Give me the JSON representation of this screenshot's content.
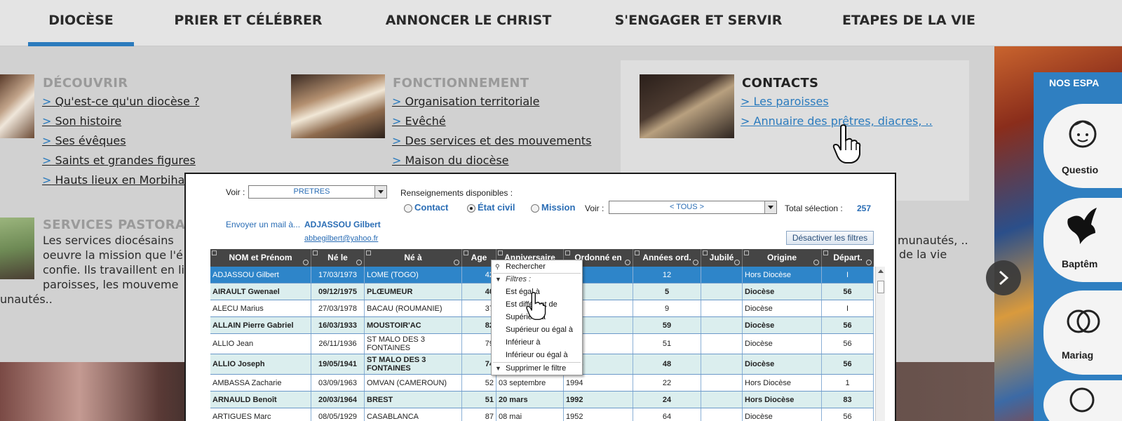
{
  "nav": {
    "items": [
      "DIOCÈSE",
      "PRIER ET CÉLÉBRER",
      "ANNONCER LE CHRIST",
      "S'ENGAGER ET SERVIR",
      "ETAPES DE LA VIE"
    ],
    "active": "DIOCÈSE",
    "accent_color": "#2b7bbd"
  },
  "menu": {
    "decouvrir": {
      "title": "DÉCOUVRIR",
      "links": [
        "Qu'est-ce qu'un diocèse ?",
        "Son histoire",
        "Ses évêques",
        "Saints et grandes figures",
        "Hauts lieux en Morbiha"
      ]
    },
    "fonctionnement": {
      "title": "FONCTIONNEMENT",
      "links": [
        "Organisation territoriale",
        "Evêché",
        "Des services et des mouvements",
        "Maison du diocèse"
      ]
    },
    "contacts": {
      "title": "CONTACTS",
      "links": [
        "Les paroisses",
        "Annuaire des prêtres, diacres, .."
      ]
    },
    "services": {
      "title": "SERVICES PASTORAU",
      "lines": [
        "Les services diocésains",
        "oeuvre la mission que l'é",
        "confie. Ils travaillent en li",
        "paroisses, les mouveme",
        "unautés.."
      ]
    },
    "right_text": [
      "munautés, ..",
      "de la vie"
    ],
    "link_prefix": ">"
  },
  "espaces": {
    "title": "NOS ESPA",
    "items": [
      "Questio",
      "Baptêm",
      "Mariag"
    ]
  },
  "app": {
    "voir_label": "Voir :",
    "voir_value": "PRETRES",
    "renseignements_label": "Renseignements disponibles :",
    "radios": [
      {
        "label": "Contact",
        "checked": false
      },
      {
        "label": "État civil",
        "checked": true
      },
      {
        "label": "Mission",
        "checked": false
      }
    ],
    "voir2_label": "Voir :",
    "voir2_value": "< TOUS >",
    "total_label": "Total sélection :",
    "total_value": "257",
    "mail_label": "Envoyer un mail à...",
    "mail_name": "ADJASSOU Gilbert",
    "mail_address": "abbegilbert@yahoo.fr",
    "disable_filters": "Désactiver les filtres",
    "columns": [
      "NOM et Prénom",
      "Né le",
      "Né à",
      "Age",
      "Anniversaire",
      "Ordonné en",
      "Années ord.",
      "Jubilé",
      "Origine",
      "Départ."
    ],
    "rows": [
      {
        "nom": "ADJASSOU Gilbert",
        "ne_le": "17/03/1973",
        "ne_a": "LOME (TOGO)",
        "age": "42",
        "anniv": "",
        "ordonne": "2004",
        "annees": "12",
        "jubile": "",
        "origine": "Hors Diocèse",
        "depart": "I"
      },
      {
        "nom": "AIRAULT Gwenael",
        "ne_le": "09/12/1975",
        "ne_a": "PLŒUMEUR",
        "age": "40",
        "anniv": "",
        "ordonne": "2011",
        "annees": "5",
        "jubile": "",
        "origine": "Diocèse",
        "depart": "56"
      },
      {
        "nom": "ALECU Marius",
        "ne_le": "27/03/1978",
        "ne_a": "BACAU (ROUMANIE)",
        "age": "37",
        "anniv": "",
        "ordonne": "2007",
        "annees": "9",
        "jubile": "",
        "origine": "Diocèse",
        "depart": "I"
      },
      {
        "nom": "ALLAIN Pierre Gabriel",
        "ne_le": "16/03/1933",
        "ne_a": "MOUSTOIR'AC",
        "age": "82",
        "anniv": "",
        "ordonne": "1957",
        "annees": "59",
        "jubile": "",
        "origine": "Diocèse",
        "depart": "56"
      },
      {
        "nom": "ALLIO Jean",
        "ne_le": "26/11/1936",
        "ne_a": "ST MALO DES 3 FONTAINES",
        "age": "79",
        "anniv": "",
        "ordonne": "1965",
        "annees": "51",
        "jubile": "",
        "origine": "Diocèse",
        "depart": "56"
      },
      {
        "nom": "ALLIO Joseph",
        "ne_le": "19/05/1941",
        "ne_a": "ST MALO DES 3 FONTAINES",
        "age": "74",
        "anniv": "",
        "ordonne": "1968",
        "annees": "48",
        "jubile": "",
        "origine": "Diocèse",
        "depart": "56"
      },
      {
        "nom": "AMBASSA Zacharie",
        "ne_le": "03/09/1963",
        "ne_a": "OMVAN (CAMEROUN)",
        "age": "52",
        "anniv": "03 septembre",
        "ordonne": "1994",
        "annees": "22",
        "jubile": "",
        "origine": "Hors Diocèse",
        "depart": "1"
      },
      {
        "nom": "ARNAULD Benoît",
        "ne_le": "20/03/1964",
        "ne_a": "BREST",
        "age": "51",
        "anniv": "20 mars",
        "ordonne": "1992",
        "annees": "24",
        "jubile": "",
        "origine": "Hors Diocèse",
        "depart": "83"
      },
      {
        "nom": "ARTIGUES Marc",
        "ne_le": "08/05/1929",
        "ne_a": "CASABLANCA",
        "age": "87",
        "anniv": "08 mai",
        "ordonne": "1952",
        "annees": "64",
        "jubile": "",
        "origine": "Diocèse",
        "depart": "56"
      }
    ],
    "context_menu": {
      "search": "Rechercher",
      "filters_header": "Filtres :",
      "filters": [
        "Est égal à",
        "Est différent de",
        "Supérieur à",
        "Supérieur ou égal à",
        "Inférieur à",
        "Inférieur ou égal à"
      ],
      "remove": "Supprimer le filtre"
    },
    "colors": {
      "header_bg": "#454545",
      "selected_row": "#2e85c9",
      "row_alt": "#dbeeee",
      "link_blue": "#2a6db5"
    }
  }
}
